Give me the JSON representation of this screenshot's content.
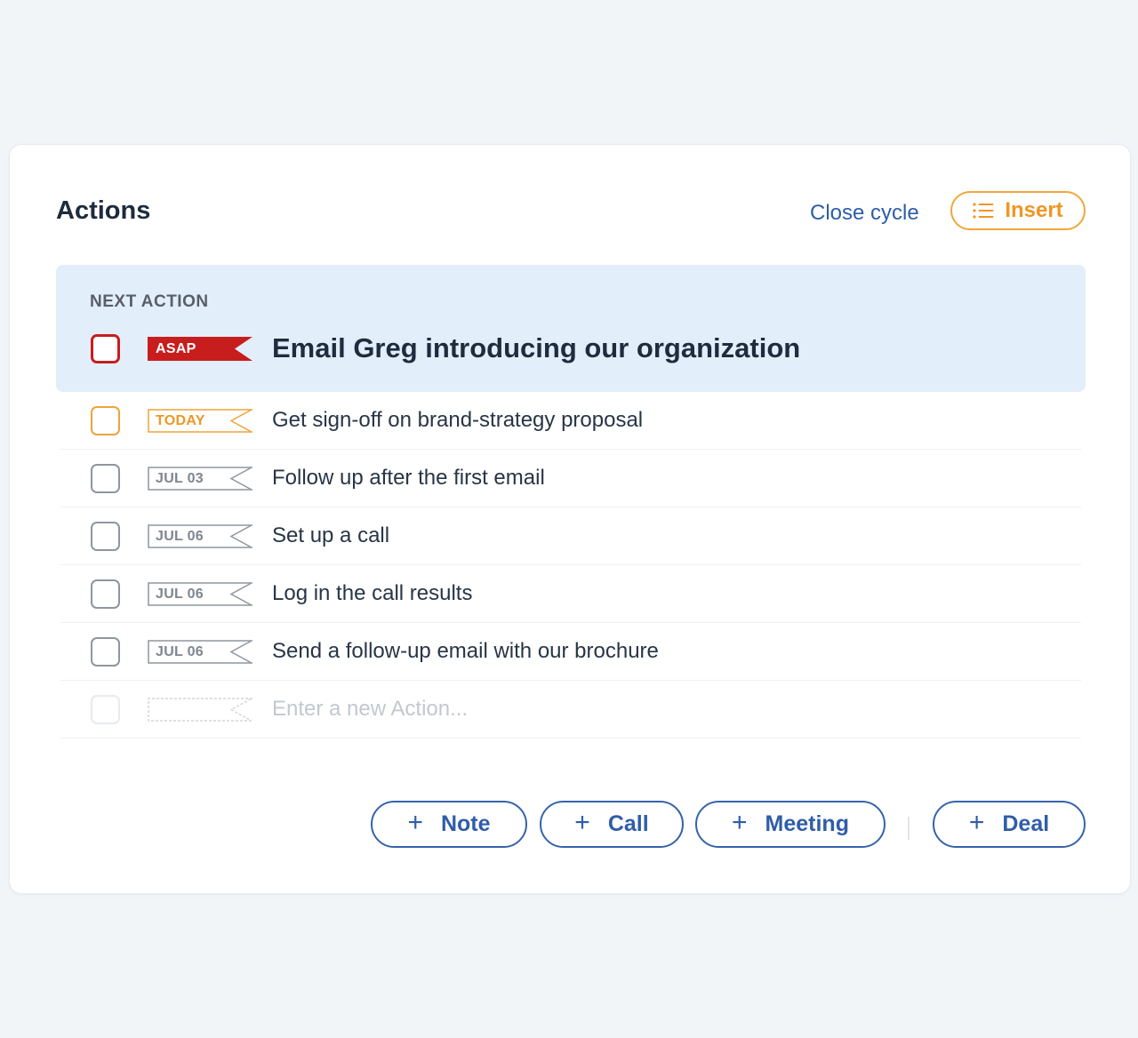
{
  "panel": {
    "title": "Actions",
    "close_cycle_label": "Close cycle",
    "insert_label": "Insert"
  },
  "next_action": {
    "section_label": "NEXT ACTION",
    "tag": "ASAP",
    "title": "Email Greg introducing our organization"
  },
  "actions": [
    {
      "tag": "TODAY",
      "label": "Get sign-off on brand-strategy proposal"
    },
    {
      "tag": "JUL 03",
      "label": "Follow up after the first email"
    },
    {
      "tag": "JUL 06",
      "label": "Set up a call"
    },
    {
      "tag": "JUL 06",
      "label": "Log in the call results"
    },
    {
      "tag": "JUL 06",
      "label": "Send a follow-up email with our brochure"
    }
  ],
  "new_action": {
    "placeholder": "Enter a new Action..."
  },
  "buttons": {
    "note": "Note",
    "call": "Call",
    "meeting": "Meeting",
    "deal": "Deal"
  },
  "colors": {
    "asap": "#c81d1d",
    "today": "#efa33b",
    "date": "#8f969e",
    "accent_blue": "#2f5da8",
    "accent_orange": "#ef9625",
    "next_bg": "#e3eefb"
  },
  "icons": {
    "insert": "list-icon",
    "add": "plus-icon"
  }
}
